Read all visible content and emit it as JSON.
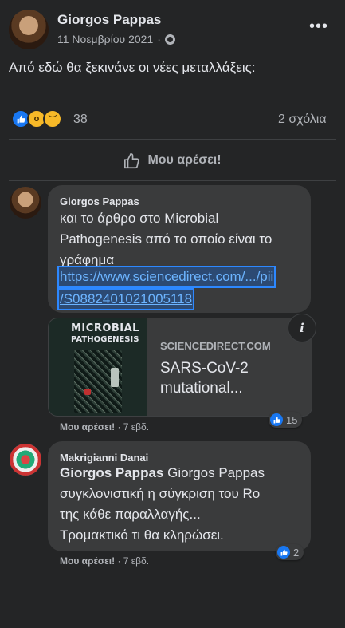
{
  "post": {
    "author": "Giorgos Pappas",
    "date": "11 Νοεμβρίου 2021",
    "privacy_icon": "globe-icon",
    "text": "Από εδώ θα ξεκινάνε οι νέες μεταλλάξεις:",
    "reaction_count": "38",
    "comment_count": "2 σχόλια",
    "like_label": "Μου αρέσει!"
  },
  "comments": [
    {
      "author": "Giorgos Pappas",
      "text_lines": [
        "και το άρθρο στο Microbial",
        "Pathogenesis από το οποίο είναι το",
        "γράφημα"
      ],
      "link_lines": [
        "https://www.sciencedirect.com/.../pii",
        "/S0882401021005118"
      ],
      "card": {
        "book_title_1": "MICROBIAL",
        "book_title_2": "PATHOGENESIS",
        "domain": "SCIENCEDIRECT.COM",
        "title_lines": [
          "SARS-CoV-2",
          "mutational..."
        ],
        "info_label": "i"
      },
      "like_action": "Μου αρέσει!",
      "time": "7 εβδ.",
      "reaction_count": "15"
    },
    {
      "author": "Makrigianni Danai",
      "mention": "Giorgos Pappas",
      "text_first": " Giorgos Pappas",
      "text_lines": [
        "συγκλονιστική η σύγκριση του Ro",
        "της κάθε παραλλαγής...",
        "Τρομακτικό τι θα κληρώσει."
      ],
      "like_action": "Μου αρέσει!",
      "time": "7 εβδ.",
      "reaction_count": "2"
    }
  ],
  "colors": {
    "background": "#242526",
    "bubble": "#3a3b3c",
    "accent": "#1877f2",
    "secondary_text": "#b0b3b8"
  }
}
